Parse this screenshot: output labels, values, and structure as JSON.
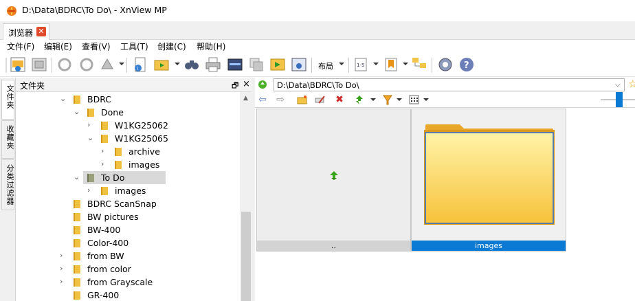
{
  "window": {
    "title": "D:\\Data\\BDRC\\To Do\\ - XnView MP"
  },
  "tabs": [
    {
      "label": "浏览器",
      "close": "✕"
    }
  ],
  "menu": [
    "文件(F)",
    "编辑(E)",
    "查看(V)",
    "工具(T)",
    "创建(C)",
    "帮助(H)"
  ],
  "toolbar": {
    "layout_label": "布局"
  },
  "side_tabs": [
    "文件夹",
    "收藏夹",
    "分类过滤器"
  ],
  "folders_panel": {
    "title": "文件夹",
    "pin": "🗗",
    "close": "×"
  },
  "tree": [
    {
      "label": "BDRC",
      "level": 0,
      "expander": "open"
    },
    {
      "label": "Done",
      "level": 1,
      "expander": "open"
    },
    {
      "label": "W1KG25062",
      "level": 2,
      "expander": "closed"
    },
    {
      "label": "W1KG25065",
      "level": 2,
      "expander": "open"
    },
    {
      "label": "archive",
      "level": 3,
      "expander": "closed"
    },
    {
      "label": "images",
      "level": 3,
      "expander": "closed"
    },
    {
      "label": "To Do",
      "level": 1,
      "expander": "open",
      "selected": true
    },
    {
      "label": "images",
      "level": 2,
      "expander": "closed"
    },
    {
      "label": "BDRC ScanSnap",
      "level": 0,
      "expander": "none"
    },
    {
      "label": "BW pictures",
      "level": 0,
      "expander": "none"
    },
    {
      "label": "BW-400",
      "level": 0,
      "expander": "none"
    },
    {
      "label": "Color-400",
      "level": 0,
      "expander": "none"
    },
    {
      "label": "from BW",
      "level": 0,
      "expander": "closed"
    },
    {
      "label": "from color",
      "level": 0,
      "expander": "closed"
    },
    {
      "label": "from Grayscale",
      "level": 0,
      "expander": "closed"
    },
    {
      "label": "GR-400",
      "level": 0,
      "expander": "none"
    }
  ],
  "address": {
    "value": "D:\\Data\\BDRC\\To Do\\"
  },
  "browser": {
    "items": [
      {
        "caption": "..",
        "kind": "parent"
      },
      {
        "caption": "images",
        "kind": "folder",
        "selected": true
      }
    ]
  },
  "colors": {
    "selection": "#0a7ad4",
    "folder": "#f5c542",
    "close_tab": "#e04a2a"
  }
}
